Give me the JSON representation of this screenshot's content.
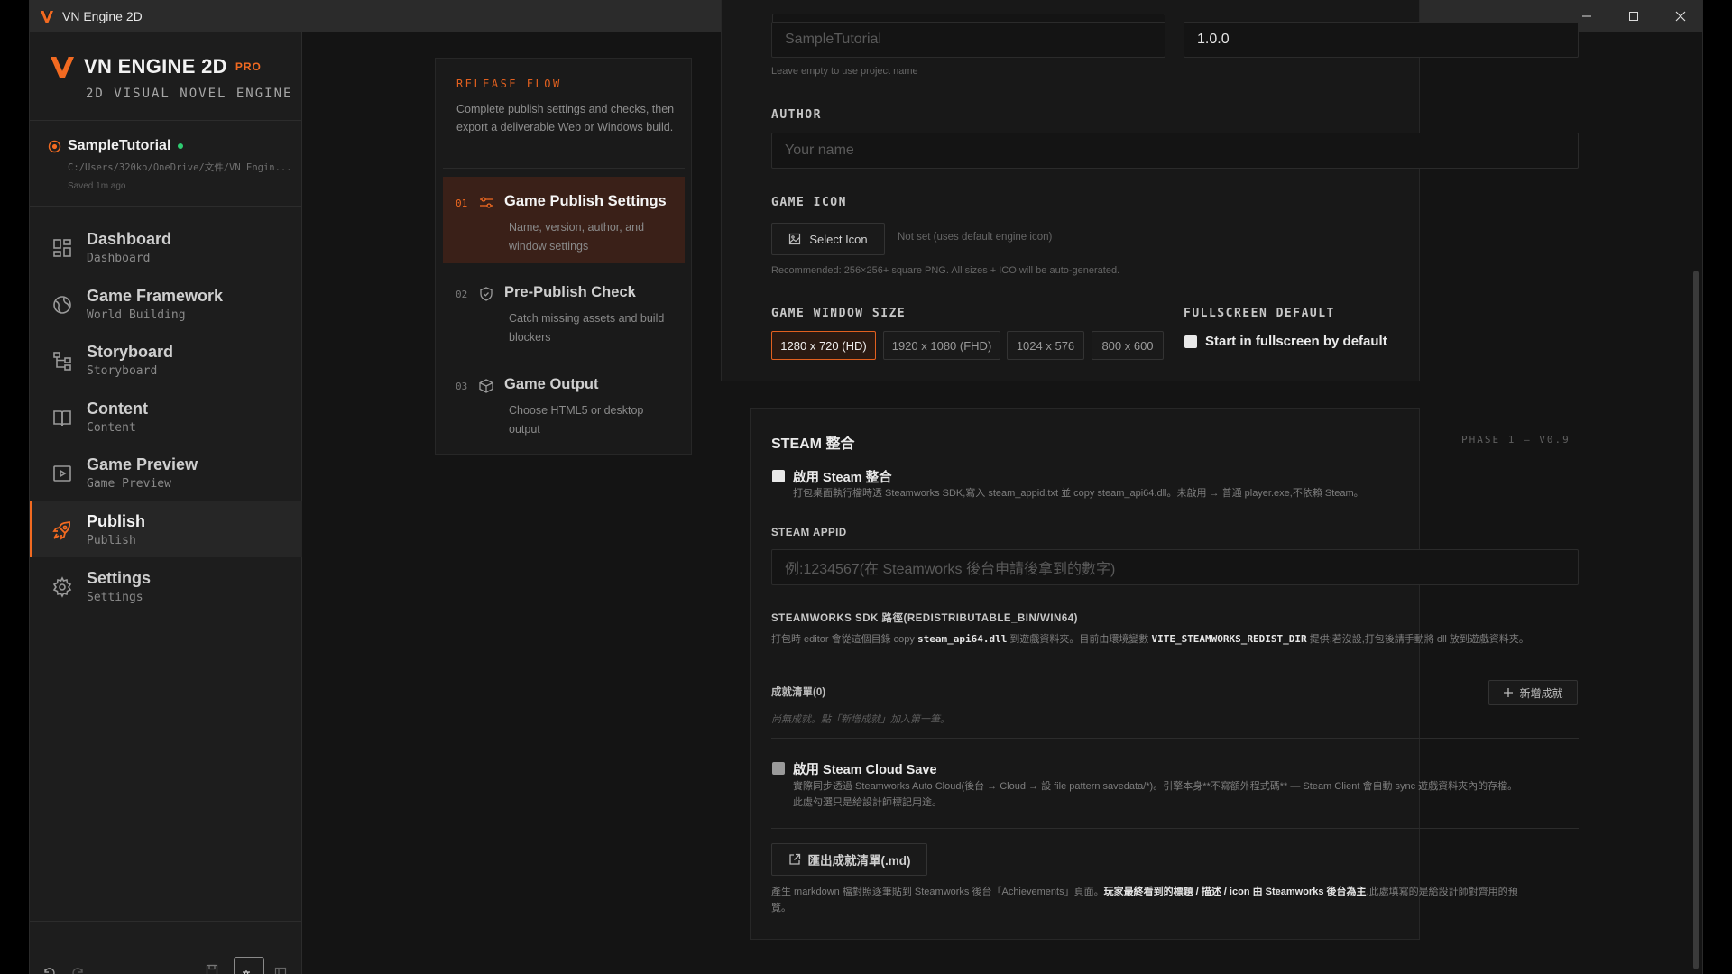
{
  "window": {
    "title": "VN Engine 2D"
  },
  "brand": {
    "title": "VN ENGINE 2D",
    "badge": "PRO",
    "subtitle": "2D VISUAL NOVEL ENGINE"
  },
  "project": {
    "name": "SampleTutorial",
    "path": "C:/Users/320ko/OneDrive/文件/VN Engin...",
    "saved": "Saved 1m ago"
  },
  "nav": [
    {
      "label": "Dashboard",
      "sub": "Dashboard",
      "icon": "dashboard-icon"
    },
    {
      "label": "Game Framework",
      "sub": "World Building",
      "icon": "globe-icon"
    },
    {
      "label": "Storyboard",
      "sub": "Storyboard",
      "icon": "flowchart-icon"
    },
    {
      "label": "Content",
      "sub": "Content",
      "icon": "book-icon"
    },
    {
      "label": "Game Preview",
      "sub": "Game Preview",
      "icon": "play-icon"
    },
    {
      "label": "Publish",
      "sub": "Publish",
      "icon": "rocket-icon",
      "active": true
    },
    {
      "label": "Settings",
      "sub": "Settings",
      "icon": "gear-icon"
    }
  ],
  "release": {
    "label": "RELEASE FLOW",
    "desc": "Complete publish settings and checks, then export a deliverable Web or Windows build.",
    "steps": [
      {
        "num": "01",
        "title": "Game Publish Settings",
        "desc": "Name, version, author, and window settings"
      },
      {
        "num": "02",
        "title": "Pre-Publish Check",
        "desc": "Catch missing assets and build blockers"
      },
      {
        "num": "03",
        "title": "Game Output",
        "desc": "Choose HTML5 or desktop output"
      }
    ]
  },
  "settings": {
    "name_placeholder": "SampleTutorial",
    "version_value": "1.0.0",
    "name_hint": "Leave empty to use project name",
    "author_label": "AUTHOR",
    "author_placeholder": "Your name",
    "icon_label": "GAME ICON",
    "select_icon": "Select Icon",
    "icon_status": "Not set (uses default engine icon)",
    "icon_hint": "Recommended: 256×256+ square PNG. All sizes + ICO will be auto-generated.",
    "window_size_label": "GAME WINDOW SIZE",
    "sizes": [
      "1280 x 720 (HD)",
      "1920 x 1080 (FHD)",
      "1024 x 576",
      "800 x 600"
    ],
    "fullscreen_label": "FULLSCREEN DEFAULT",
    "fullscreen_option": "Start in fullscreen by default"
  },
  "steam": {
    "title": "STEAM 整合",
    "phase": "PHASE 1 — V0.9",
    "enable_label": "啟用 Steam 整合",
    "enable_desc": "打包桌面執行檔時透 Steamworks SDK,寫入 steam_appid.txt 並 copy steam_api64.dll。未啟用 → 普通 player.exe,不依賴 Steam。",
    "appid_label": "STEAM APPID",
    "appid_placeholder": "例:1234567(在 Steamworks 後台申請後拿到的數字)",
    "sdk_label": "STEAMWORKS SDK 路徑(REDISTRIBUTABLE_BIN/WIN64)",
    "sdk_desc_1": "打包時 editor 會從這個目錄 copy ",
    "sdk_desc_bold_1": "steam_api64.dll",
    "sdk_desc_2": " 到遊戲資料夾。目前由環境變數 ",
    "sdk_desc_bold_2": "VITE_STEAMWORKS_REDIST_DIR",
    "sdk_desc_3": " 提供;若沒設,打包後請手動將 dll 放到遊戲資料夾。",
    "achievements_label": "成就清單(0)",
    "add_achievement": "新增成就",
    "achievements_empty": "尚無成就。點「新增成就」加入第一筆。",
    "cloud_label": "啟用 Steam Cloud Save",
    "cloud_desc_1": "實際同步透過 Steamworks Auto Cloud(後台 → Cloud → 設 file pattern savedata/*)。引擎本身**不寫額外程式碼** — Steam Client 會自動 sync 遊戲資料夾內的存檔。",
    "cloud_desc_2": "此處勾選只是給設計師標記用途。",
    "export_label": "匯出成就清單(.md)",
    "export_desc_1": "產生 markdown 檔對照逐筆貼到 Steamworks 後台「Achievements」頁面。",
    "export_desc_bold": "玩家最終看到的標題 / 描述 / icon 由 Steamworks 後台為主",
    "export_desc_2": ",此處填寫的是給設計師對齊用的預",
    "export_desc_3": "覽。"
  },
  "colors": {
    "accent": "#f26a21",
    "online": "#2ecc71",
    "bg": "#141414"
  }
}
